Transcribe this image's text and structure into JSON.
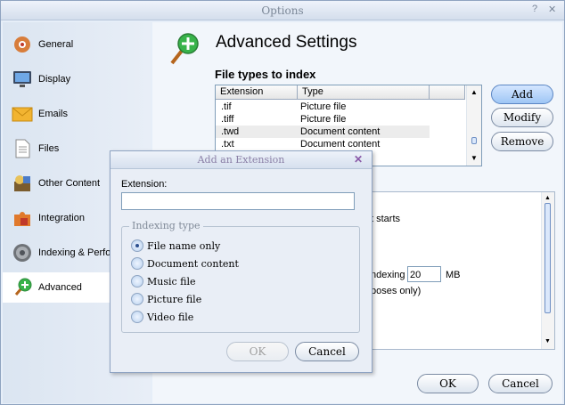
{
  "window": {
    "title": "Options"
  },
  "sidebar": {
    "items": [
      {
        "label": "General"
      },
      {
        "label": "Display"
      },
      {
        "label": "Emails"
      },
      {
        "label": "Files"
      },
      {
        "label": "Other Content"
      },
      {
        "label": "Integration"
      },
      {
        "label": "Indexing & Perfo"
      },
      {
        "label": "Advanced"
      }
    ]
  },
  "main": {
    "title": "Advanced Settings",
    "file_types_heading": "File types to index",
    "columns": [
      "Extension",
      "Type"
    ],
    "rows": [
      {
        "ext": ".tif",
        "type": "Picture file"
      },
      {
        "ext": ".tiff",
        "type": "Picture file"
      },
      {
        "ext": ".twd",
        "type": "Document content"
      },
      {
        "ext": ".txt",
        "type": "Document content"
      }
    ],
    "buttons": {
      "add": "Add",
      "modify": "Modify",
      "remove": "Remove"
    },
    "partial": {
      "starts": "t starts",
      "indexing": "ndexing",
      "size_value": "20",
      "unit": "MB",
      "purposes": "poses only)"
    }
  },
  "footer": {
    "ok": "OK",
    "cancel": "Cancel"
  },
  "dialog": {
    "title": "Add an Extension",
    "extension_label": "Extension:",
    "extension_value": "",
    "group_label": "Indexing type",
    "options": [
      {
        "label": "File name only",
        "selected": true
      },
      {
        "label": "Document content",
        "selected": false
      },
      {
        "label": "Music file",
        "selected": false
      },
      {
        "label": "Picture file",
        "selected": false
      },
      {
        "label": "Video file",
        "selected": false
      }
    ],
    "ok": "OK",
    "cancel": "Cancel"
  }
}
